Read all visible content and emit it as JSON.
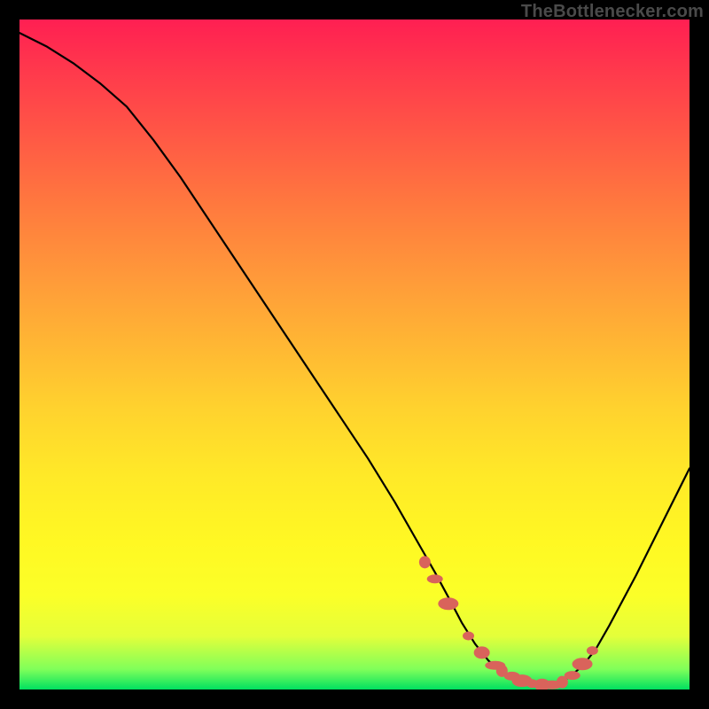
{
  "watermark": "TheBottlenecker.com",
  "chart_data": {
    "type": "line",
    "title": "",
    "xlabel": "",
    "ylabel": "",
    "xlim": [
      0,
      100
    ],
    "ylim": [
      0,
      100
    ],
    "series": [
      {
        "name": "bottleneck-curve",
        "x": [
          0,
          4,
          8,
          12,
          16,
          20,
          24,
          28,
          32,
          36,
          40,
          44,
          48,
          52,
          56,
          60,
          62,
          64,
          66,
          68,
          70,
          72,
          74,
          76,
          78,
          80,
          82,
          84,
          86,
          88,
          92,
          96,
          100
        ],
        "y": [
          98,
          96,
          93.5,
          90.5,
          87,
          82,
          76.5,
          70.5,
          64.5,
          58.5,
          52.5,
          46.5,
          40.5,
          34.5,
          28,
          21,
          17.5,
          13.8,
          10,
          6.8,
          4.3,
          2.5,
          1.3,
          0.8,
          0.6,
          0.9,
          1.8,
          3.5,
          6,
          9.5,
          17,
          25,
          33
        ]
      }
    ],
    "markers": {
      "name": "highlight-dots",
      "x": [
        60.5,
        62,
        64,
        67,
        69,
        71,
        72,
        73.5,
        75,
        76.5,
        78,
        79.5,
        81,
        82.5,
        84,
        85.5
      ],
      "y": [
        19,
        16.5,
        12.8,
        8,
        5.5,
        3.6,
        2.8,
        2,
        1.3,
        0.9,
        0.7,
        0.7,
        1.1,
        2.1,
        3.8,
        5.8
      ]
    },
    "colors": {
      "curve": "#000000",
      "markers": "#d9635b",
      "gradient_top": "#ff1f52",
      "gradient_bottom": "#00e060",
      "frame": "#000000"
    }
  }
}
